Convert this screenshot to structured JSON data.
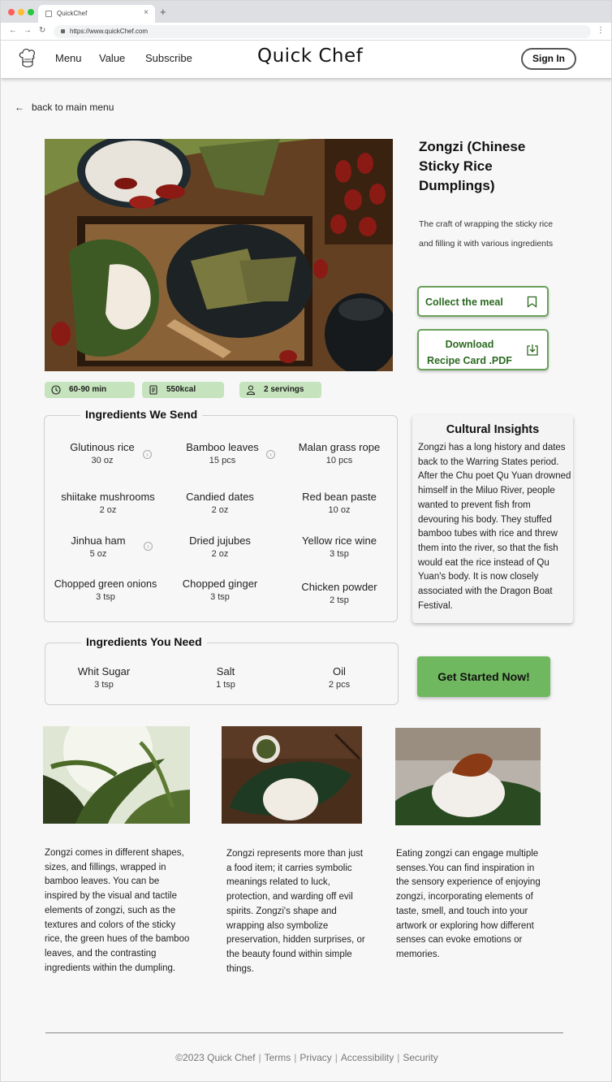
{
  "browser": {
    "tab_title": "QuickChef",
    "url": "https://www.quickChef.com",
    "new_tab_icon": "+",
    "close_icon": "×"
  },
  "header": {
    "nav": [
      "Menu",
      "Value",
      "Subscribe"
    ],
    "brand": "Quick Chef",
    "sign_in": "Sign In"
  },
  "back_link": "back to main menu",
  "dish": {
    "title": "Zongzi (Chinese Sticky Rice Dumplings)",
    "description": "The craft of wrapping the sticky rice and filling it with various ingredients",
    "collect_label": "Collect the meal",
    "download_label_1": "Download",
    "download_label_2": "Recipe Card .PDF",
    "time": "60-90 min",
    "calories": "550kcal",
    "servings": "2 servings"
  },
  "ingredients_we_send": {
    "title": "Ingredients We Send",
    "items": [
      {
        "name": "Glutinous rice",
        "qty": "30 oz",
        "info": true
      },
      {
        "name": "Bamboo leaves",
        "qty": "15 pcs",
        "info": true
      },
      {
        "name": "Malan grass rope",
        "qty": "10 pcs",
        "info": false
      },
      {
        "name": "shiitake mushrooms",
        "qty": "2 oz",
        "info": false
      },
      {
        "name": "Candied dates",
        "qty": "2 oz",
        "info": false
      },
      {
        "name": "Red bean paste",
        "qty": "10 oz",
        "info": false
      },
      {
        "name": "Jinhua ham",
        "qty": "5 oz",
        "info": true
      },
      {
        "name": "Dried jujubes",
        "qty": "2 oz",
        "info": false
      },
      {
        "name": "Yellow rice wine",
        "qty": "3 tsp",
        "info": false
      },
      {
        "name": "Chopped green onions",
        "qty": "3 tsp",
        "info": false
      },
      {
        "name": "Chopped ginger",
        "qty": "3 tsp",
        "info": false
      },
      {
        "name": "Chicken powder",
        "qty": "2 tsp",
        "info": false
      }
    ]
  },
  "cultural_insights": {
    "title": "Cultural Insights",
    "text": "Zongzi has a long history and dates back to the Warring States period. After the Chu poet Qu Yuan drowned himself in the Miluo River, people wanted to prevent fish from devouring his body. They stuffed bamboo tubes with rice and threw them into the river, so that the fish would eat the rice instead of Qu Yuan's body.  It is now closely associated with the Dragon Boat Festival."
  },
  "ingredients_you_need": {
    "title": "Ingredients You Need",
    "items": [
      {
        "name": "Whit Sugar",
        "qty": "3 tsp"
      },
      {
        "name": "Salt",
        "qty": "1 tsp"
      },
      {
        "name": "Oil",
        "qty": "2 pcs"
      }
    ]
  },
  "cta": "Get Started Now!",
  "gallery": [
    {
      "text": "Zongzi comes in different shapes, sizes, and fillings, wrapped in bamboo leaves. You can be inspired by the visual and tactile elements of zongzi, such as the textures and colors of the sticky rice, the green hues of the bamboo leaves, and the contrasting ingredients within the dumpling."
    },
    {
      "text": "Zongzi represents more than just a food item; it carries symbolic meanings related to luck, protection, and warding off evil spirits.  Zongzi's shape and wrapping also symbolize preservation, hidden surprises, or the beauty found within simple things."
    },
    {
      "text": "Eating zongzi can engage multiple senses.You can find inspiration in the sensory experience of enjoying zongzi, incorporating elements of taste, smell, and touch into your artwork or exploring how different senses can evoke emotions or memories."
    }
  ],
  "footer": {
    "copyright": "©2023 Quick Chef",
    "links": [
      "Terms",
      "Privacy",
      "Accessibility",
      "Security"
    ]
  },
  "colors": {
    "accent_green": "#6fb85f",
    "chip_green": "#c5e3bc",
    "outline_green": "#6aa05a"
  }
}
